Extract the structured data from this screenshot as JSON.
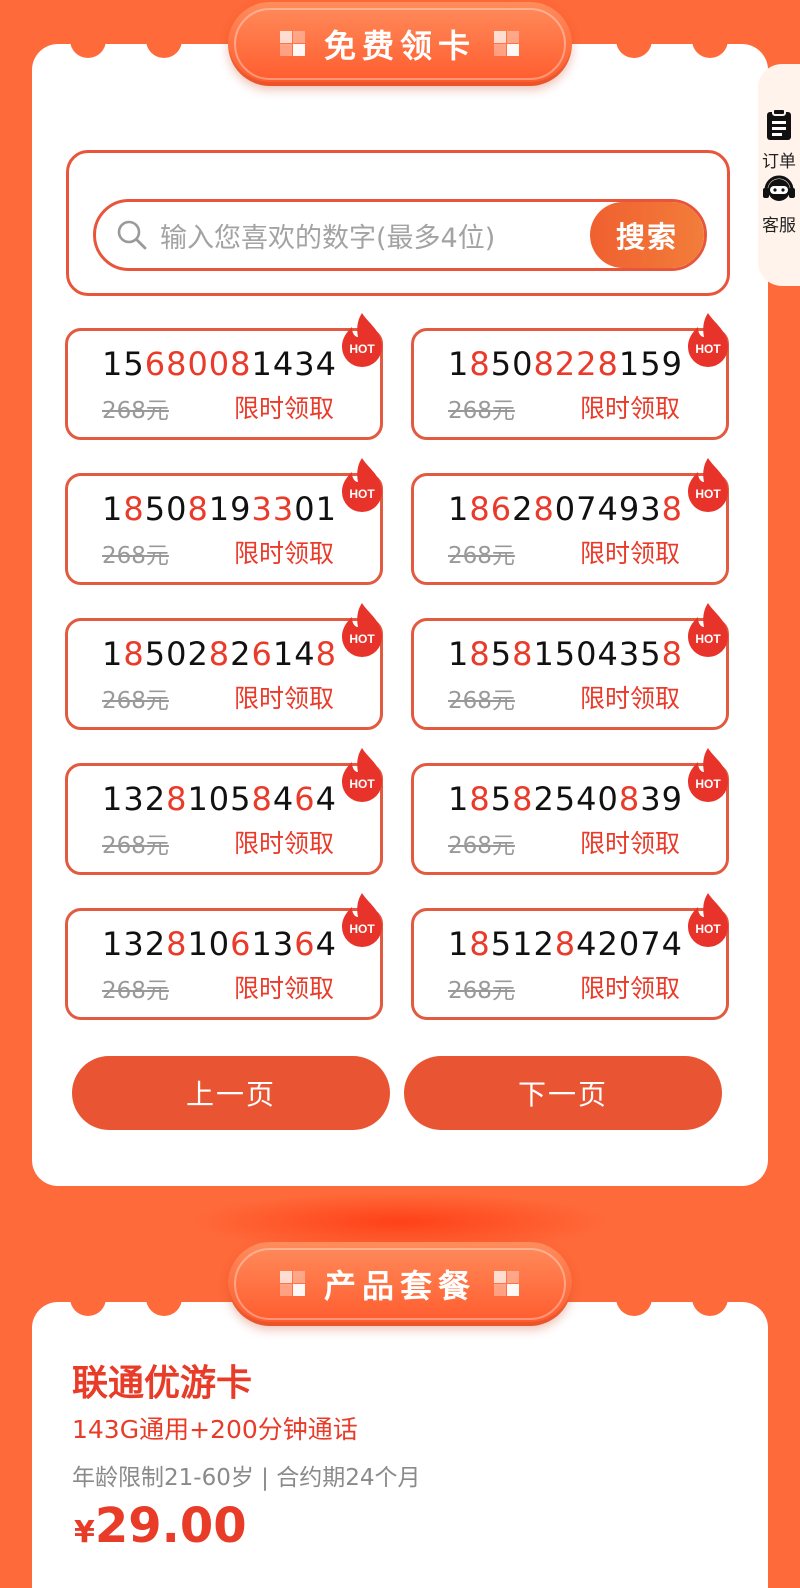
{
  "banner_free": "免费领卡",
  "banner_plan": "产品套餐",
  "search": {
    "placeholder": "输入您喜欢的数字(最多4位)",
    "button": "搜索"
  },
  "side": {
    "orders": "订单",
    "service": "客服"
  },
  "numbers": [
    {
      "parts": [
        [
          "15",
          0
        ],
        [
          "68008",
          1
        ],
        [
          "1434",
          0
        ]
      ],
      "old_price": "268元",
      "claim": "限时领取"
    },
    {
      "parts": [
        [
          "1",
          0
        ],
        [
          "8",
          1
        ],
        [
          "50",
          0
        ],
        [
          "8228",
          1
        ],
        [
          "159",
          0
        ]
      ],
      "old_price": "268元",
      "claim": "限时领取"
    },
    {
      "parts": [
        [
          "1",
          0
        ],
        [
          "8",
          1
        ],
        [
          "50",
          0
        ],
        [
          "8",
          1
        ],
        [
          "19",
          0
        ],
        [
          "33",
          1
        ],
        [
          "01",
          0
        ]
      ],
      "old_price": "268元",
      "claim": "限时领取"
    },
    {
      "parts": [
        [
          "1",
          0
        ],
        [
          "86",
          1
        ],
        [
          "2",
          0
        ],
        [
          "8",
          1
        ],
        [
          "07493",
          0
        ],
        [
          "8",
          1
        ]
      ],
      "old_price": "268元",
      "claim": "限时领取"
    },
    {
      "parts": [
        [
          "1",
          0
        ],
        [
          "8",
          1
        ],
        [
          "502",
          0
        ],
        [
          "8",
          1
        ],
        [
          "2",
          0
        ],
        [
          "6",
          1
        ],
        [
          "14",
          0
        ],
        [
          "8",
          1
        ]
      ],
      "old_price": "268元",
      "claim": "限时领取"
    },
    {
      "parts": [
        [
          "1",
          0
        ],
        [
          "8",
          1
        ],
        [
          "5",
          0
        ],
        [
          "8",
          1
        ],
        [
          "150435",
          0
        ],
        [
          "8",
          1
        ]
      ],
      "old_price": "268元",
      "claim": "限时领取"
    },
    {
      "parts": [
        [
          "132",
          0
        ],
        [
          "8",
          1
        ],
        [
          "105",
          0
        ],
        [
          "8",
          1
        ],
        [
          "4",
          0
        ],
        [
          "6",
          1
        ],
        [
          "4",
          0
        ]
      ],
      "old_price": "268元",
      "claim": "限时领取"
    },
    {
      "parts": [
        [
          "1",
          0
        ],
        [
          "8",
          1
        ],
        [
          "5",
          0
        ],
        [
          "8",
          1
        ],
        [
          "2540",
          0
        ],
        [
          "8",
          1
        ],
        [
          "39",
          0
        ]
      ],
      "old_price": "268元",
      "claim": "限时领取"
    },
    {
      "parts": [
        [
          "132",
          0
        ],
        [
          "8",
          1
        ],
        [
          "10",
          0
        ],
        [
          "6",
          1
        ],
        [
          "13",
          0
        ],
        [
          "6",
          1
        ],
        [
          "4",
          0
        ]
      ],
      "old_price": "268元",
      "claim": "限时领取"
    },
    {
      "parts": [
        [
          "1",
          0
        ],
        [
          "8",
          1
        ],
        [
          "512",
          0
        ],
        [
          "8",
          1
        ],
        [
          "42074",
          0
        ]
      ],
      "old_price": "268元",
      "claim": "限时领取"
    }
  ],
  "hot_label": "HOT",
  "pager": {
    "prev": "上一页",
    "next": "下一页"
  },
  "product": {
    "title": "联通优游卡",
    "subtitle": "143G通用+200分钟通话",
    "meta": "年龄限制21-60岁 | 合约期24个月",
    "currency": "¥",
    "price": "29.00"
  },
  "colors": {
    "background": "#ff6a3a",
    "accent_red": "#ea3b2a",
    "button": "#e95432"
  }
}
